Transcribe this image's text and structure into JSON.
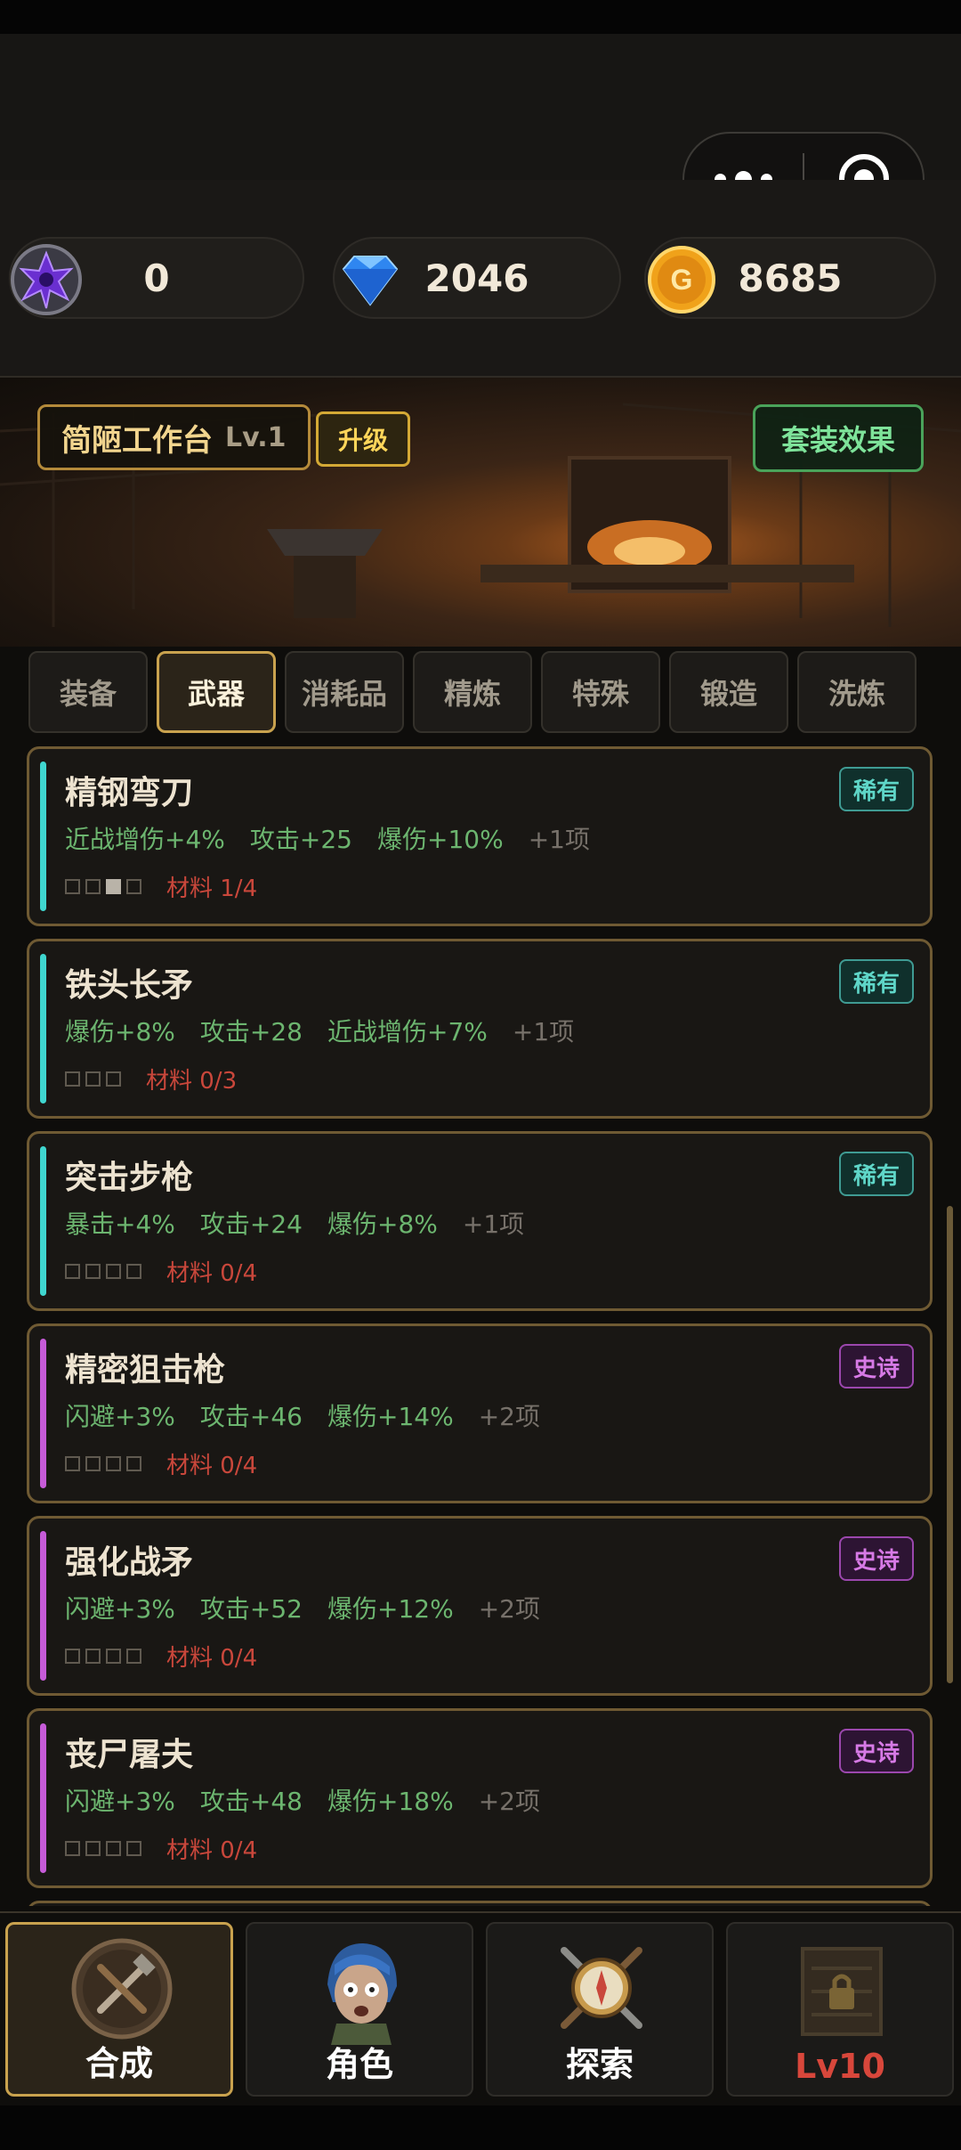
{
  "resources": {
    "crystal": {
      "value": "0",
      "icon": "purple-crystal-icon"
    },
    "diamond": {
      "value": "2046",
      "icon": "diamond-icon"
    },
    "gold": {
      "value": "8685",
      "icon": "gold-coin-icon"
    }
  },
  "workbench": {
    "name": "简陋工作台",
    "level": "Lv.1",
    "upgrade_label": "升级",
    "set_effect_label": "套装效果"
  },
  "tabs": [
    {
      "label": "装备",
      "active": false
    },
    {
      "label": "武器",
      "active": true
    },
    {
      "label": "消耗品",
      "active": false
    },
    {
      "label": "精炼",
      "active": false
    },
    {
      "label": "特殊",
      "active": false
    },
    {
      "label": "锻造",
      "active": false
    },
    {
      "label": "洗炼",
      "active": false
    }
  ],
  "items": [
    {
      "name": "精钢弯刀",
      "rarity": "稀有",
      "stats": [
        "近战增伤+4%",
        "攻击+25",
        "爆伤+10%"
      ],
      "more": "+1项",
      "materials": "材料 1/4",
      "slots": [
        false,
        false,
        true,
        false
      ]
    },
    {
      "name": "铁头长矛",
      "rarity": "稀有",
      "stats": [
        "爆伤+8%",
        "攻击+28",
        "近战增伤+7%"
      ],
      "more": "+1项",
      "materials": "材料 0/3",
      "slots": [
        false,
        false,
        false
      ]
    },
    {
      "name": "突击步枪",
      "rarity": "稀有",
      "stats": [
        "暴击+4%",
        "攻击+24",
        "爆伤+8%"
      ],
      "more": "+1项",
      "materials": "材料 0/4",
      "slots": [
        false,
        false,
        false,
        false
      ]
    },
    {
      "name": "精密狙击枪",
      "rarity": "史诗",
      "stats": [
        "闪避+3%",
        "攻击+46",
        "爆伤+14%"
      ],
      "more": "+2项",
      "materials": "材料 0/4",
      "slots": [
        false,
        false,
        false,
        false
      ]
    },
    {
      "name": "强化战矛",
      "rarity": "史诗",
      "stats": [
        "闪避+3%",
        "攻击+52",
        "爆伤+12%"
      ],
      "more": "+2项",
      "materials": "材料 0/4",
      "slots": [
        false,
        false,
        false,
        false
      ]
    },
    {
      "name": "丧尸屠夫",
      "rarity": "史诗",
      "stats": [
        "闪避+3%",
        "攻击+48",
        "爆伤+18%"
      ],
      "more": "+2项",
      "materials": "材料 0/4",
      "slots": [
        false,
        false,
        false,
        false
      ]
    }
  ],
  "rarity_colors": {
    "稀有": {
      "bar": "#3fd6cf",
      "text": "#5fd6c8",
      "border": "#3f9b93",
      "bg": "#10302c"
    },
    "史诗": {
      "bar": "#c65bd8",
      "text": "#d77ae6",
      "border": "#9b47ad",
      "bg": "#2d1433"
    }
  },
  "nav": [
    {
      "label": "合成",
      "active": true,
      "icon": "crafting-icon"
    },
    {
      "label": "角色",
      "active": false,
      "icon": "character-portrait-icon"
    },
    {
      "label": "探索",
      "active": false,
      "icon": "compass-icon"
    },
    {
      "label": "Lv10",
      "active": false,
      "locked": true,
      "icon": "locked-shop-icon"
    }
  ]
}
